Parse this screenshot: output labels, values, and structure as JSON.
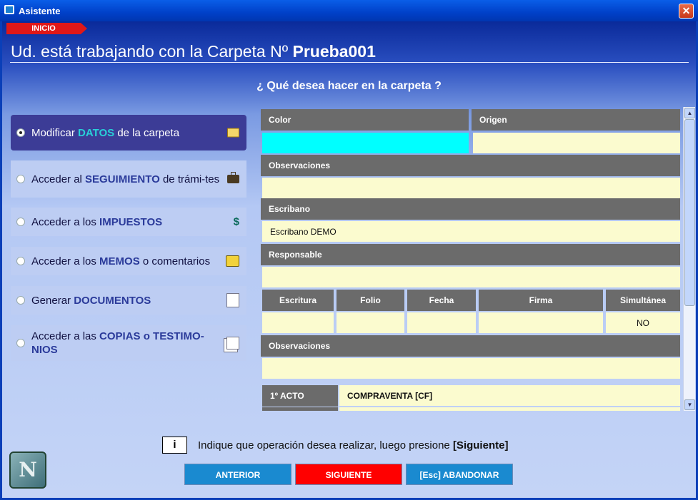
{
  "window": {
    "title": "Asistente",
    "close_label": "✕"
  },
  "header": {
    "tab_label": "INICIO",
    "headline_prefix": "Ud. está trabajando con la Carpeta Nº ",
    "folder_name": "Prueba001"
  },
  "question": "¿ Qué desea hacer en la carpeta ?",
  "options": [
    {
      "pre": "Modificar ",
      "kw": "DATOS",
      "post": " de la carpeta",
      "icon": "folder-icon",
      "selected": true
    },
    {
      "pre": "Acceder al ",
      "kw": "SEGUIMIENTO",
      "post": " de trámi-tes",
      "icon": "briefcase-icon",
      "selected": false
    },
    {
      "pre": "Acceder a los ",
      "kw": "IMPUESTOS",
      "post": "",
      "icon": "dollar-icon",
      "selected": false
    },
    {
      "pre": "Acceder a los ",
      "kw": "MEMOS",
      "post": " o comentarios",
      "icon": "memo-icon",
      "selected": false
    },
    {
      "pre": "Generar ",
      "kw": "DOCUMENTOS",
      "post": "",
      "icon": "page-icon",
      "selected": false
    },
    {
      "pre": "Acceder a las ",
      "kw": "COPIAS o TESTIMO-NIOS",
      "post": "",
      "icon": "copies-icon",
      "selected": false
    }
  ],
  "panel": {
    "color_label": "Color",
    "origen_label": "Origen",
    "color_value": "",
    "origen_value": "",
    "observaciones_label": "Observaciones",
    "observaciones_value": "",
    "escribano_label": "Escribano",
    "escribano_value": "Escribano DEMO",
    "responsable_label": "Responsable",
    "responsable_value": "",
    "grid_headers": [
      "Escritura",
      "Folio",
      "Fecha",
      "Firma",
      "Simultánea"
    ],
    "grid_values": [
      "",
      "",
      "",
      "",
      "NO"
    ],
    "observaciones2_label": "Observaciones",
    "observaciones2_value": "",
    "acto_label": "1º ACTO",
    "acto_value": "COMPRAVENTA [CF]",
    "color_highlight": "#00ffff"
  },
  "info": {
    "badge": "i",
    "text": "Indique que operación desea realizar, luego presione ",
    "text_bold": "[Siguiente]"
  },
  "logo_text": "N",
  "buttons": {
    "previous": "ANTERIOR",
    "next": "SIGUIENTE",
    "abandon": "[Esc] ABANDONAR"
  }
}
